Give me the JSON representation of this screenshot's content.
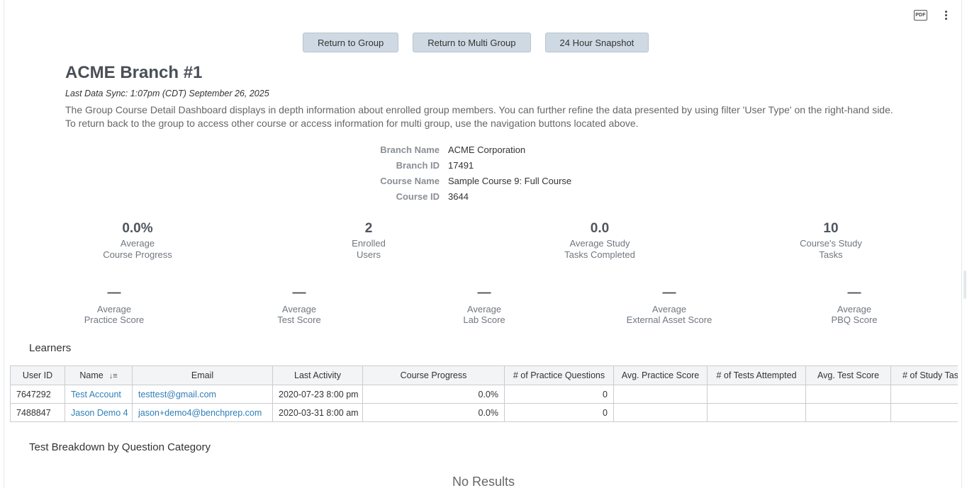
{
  "toolbar": {
    "pdf_label": "PDF",
    "more_icon": "more-vertical-icon"
  },
  "nav": {
    "return_group": "Return to Group",
    "return_multi": "Return to Multi Group",
    "snapshot": "24 Hour Snapshot"
  },
  "header": {
    "title": "ACME Branch #1",
    "sync": "Last Data Sync: 1:07pm (CDT) September 26, 2025",
    "description": "The Group Course Detail Dashboard displays in depth information about enrolled group members. You can further refine the data presented by using filter 'User Type' on the right-hand side. To return back to the group to access other course or access information for multi group, use the navigation buttons located above."
  },
  "info": {
    "branch_name_label": "Branch Name",
    "branch_name": "ACME Corporation",
    "branch_id_label": "Branch ID",
    "branch_id": "17491",
    "course_name_label": "Course Name",
    "course_name": "Sample Course 9: Full Course",
    "course_id_label": "Course ID",
    "course_id": "3644"
  },
  "kpis": [
    {
      "value": "0.0%",
      "line1": "Average",
      "line2": "Course Progress"
    },
    {
      "value": "2",
      "line1": "Enrolled",
      "line2": "Users"
    },
    {
      "value": "0.0",
      "line1": "Average Study",
      "line2": "Tasks Completed"
    },
    {
      "value": "10",
      "line1": "Course's Study",
      "line2": "Tasks"
    }
  ],
  "scores": [
    {
      "value": "—",
      "line1": "Average",
      "line2": "Practice Score"
    },
    {
      "value": "—",
      "line1": "Average",
      "line2": "Test Score"
    },
    {
      "value": "—",
      "line1": "Average",
      "line2": "Lab Score"
    },
    {
      "value": "—",
      "line1": "Average",
      "line2": "External Asset Score"
    },
    {
      "value": "—",
      "line1": "Average",
      "line2": "PBQ Score"
    }
  ],
  "learners": {
    "title": "Learners",
    "columns": [
      "User ID",
      "Name",
      "Email",
      "Last Activity",
      "Course Progress",
      "# of Practice Questions",
      "Avg. Practice Score",
      "# of Tests Attempted",
      "Avg. Test Score",
      "# of Study Tasks"
    ],
    "rows": [
      [
        "7647292",
        "Test Account",
        "testtest@gmail.com",
        "2020-07-23 8:00 pm",
        "0.0%",
        "0",
        "",
        "",
        "",
        ""
      ],
      [
        "7488847",
        "Jason Demo 4",
        "jason+demo4@benchprep.com",
        "2020-03-31 8:00 am",
        "0.0%",
        "0",
        "",
        "",
        "",
        ""
      ]
    ]
  },
  "breakdown": {
    "title": "Test Breakdown by Question Category",
    "empty": "No Results"
  }
}
